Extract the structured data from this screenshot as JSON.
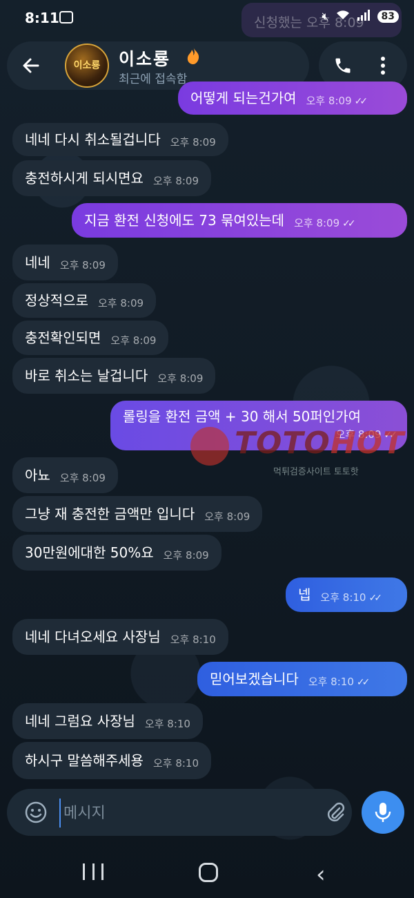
{
  "status_bar": {
    "time": "8:11",
    "battery": "83"
  },
  "ghost_message": "신청했는   오후 8:09",
  "header": {
    "contact_name": "이소룡",
    "avatar_text": "이소룡",
    "contact_status": "최근에 접속함"
  },
  "messages": [
    {
      "text": "어떻게 되는건가여",
      "time": "오후 8:09",
      "dir": "out",
      "color": "purple"
    },
    {
      "text": "네네 다시 취소될겁니다",
      "time": "오후 8:09",
      "dir": "in"
    },
    {
      "text": "충전하시게 되시면요",
      "time": "오후 8:09",
      "dir": "in"
    },
    {
      "text": "지금 환전 신청에도 73 묶여있는데",
      "time": "오후 8:09",
      "dir": "out",
      "color": "purple"
    },
    {
      "text": "네네",
      "time": "오후 8:09",
      "dir": "in"
    },
    {
      "text": "정상적으로",
      "time": "오후 8:09",
      "dir": "in"
    },
    {
      "text": "충전확인되면",
      "time": "오후 8:09",
      "dir": "in"
    },
    {
      "text": "바로 취소는 날겁니다",
      "time": "오후 8:09",
      "dir": "in"
    },
    {
      "text": "롤링을 환전 금액 + 30 해서 50퍼인가여",
      "time": "오후 8:09",
      "dir": "out",
      "color": "mix"
    },
    {
      "text": "아뇨",
      "time": "오후 8:09",
      "dir": "in"
    },
    {
      "text": "그냥 재 충전한 금액만 입니다",
      "time": "오후 8:09",
      "dir": "in"
    },
    {
      "text": "30만원에대한 50%요",
      "time": "오후 8:09",
      "dir": "in"
    },
    {
      "text": "넵",
      "time": "오후 8:10",
      "dir": "out",
      "color": "blue"
    },
    {
      "text": "네네 다녀오세요 사장님",
      "time": "오후 8:10",
      "dir": "in"
    },
    {
      "text": "믿어보겠습니다",
      "time": "오후 8:10",
      "dir": "out",
      "color": "blue"
    },
    {
      "text": "네네 그럼요 사장님",
      "time": "오후 8:10",
      "dir": "in"
    },
    {
      "text": "하시구 말씀해주세용",
      "time": "오후 8:10",
      "dir": "in"
    }
  ],
  "watermark": {
    "brand_a": "TOTO",
    "brand_b": "HOT",
    "tagline": "먹튀검증사이트 토토핫"
  },
  "input": {
    "placeholder": "메시지"
  },
  "colors": {
    "accent": "#3d8ef0",
    "outgoing_purple": "#8a44dc",
    "outgoing_blue": "#3a6fe4",
    "incoming": "#1f2b37"
  }
}
